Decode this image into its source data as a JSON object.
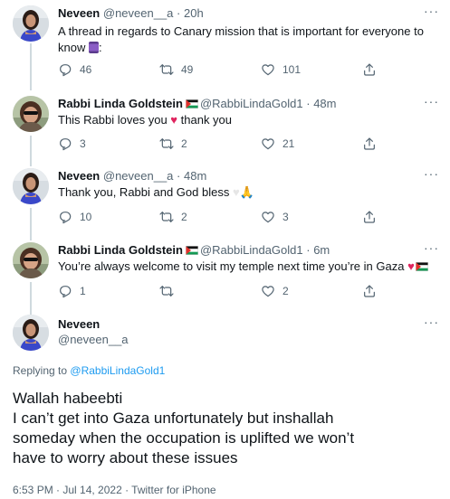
{
  "tweets": [
    {
      "name": "Neveen",
      "handle": "@neveen__a",
      "time": "· 20h",
      "text": "A thread in regards to Canary mission that is important for everyone to know",
      "text_tail": ":",
      "replies": "46",
      "retweets": "49",
      "likes": "101"
    },
    {
      "name": "Rabbi Linda Goldstein",
      "handle": "@RabbiLindaGold1",
      "time": "· 48m",
      "text": "This Rabbi loves you",
      "text_tail": "thank you",
      "replies": "3",
      "retweets": "2",
      "likes": "21"
    },
    {
      "name": "Neveen",
      "handle": "@neveen__a",
      "time": "· 48m",
      "text": "Thank you, Rabbi and God bless",
      "replies": "10",
      "retweets": "2",
      "likes": "3"
    },
    {
      "name": "Rabbi Linda Goldstein",
      "handle": "@RabbiLindaGold1",
      "time": "· 6m",
      "text": "You’re always welcome to visit my temple next time you’re in Gaza",
      "replies": "1",
      "retweets": "",
      "likes": "2"
    }
  ],
  "main": {
    "name": "Neveen",
    "handle": "@neveen__a",
    "replying_prefix": "Replying to",
    "replying_to": "@RabbiLindaGold1",
    "text_lines": [
      "Wallah habeebti",
      "I can’t get into Gaza unfortunately but inshallah",
      "someday when the occupation is uplifted we won’t",
      "have to worry about these issues"
    ],
    "meta": "6:53 PM · Jul 14, 2022 · Twitter for iPhone"
  },
  "icons": {
    "reply": "reply-icon",
    "retweet": "retweet-icon",
    "like": "like-icon",
    "share": "share-icon",
    "more": "more-icon",
    "flag": "palestine-flag-icon",
    "spool": "thread-spool-emoji",
    "red_heart": "red-heart-emoji",
    "white_heart": "white-heart-emoji",
    "pray": "folded-hands-emoji"
  },
  "colors": {
    "link": "#1d9bf0",
    "muted": "#536471",
    "heart": "#e0245e"
  }
}
